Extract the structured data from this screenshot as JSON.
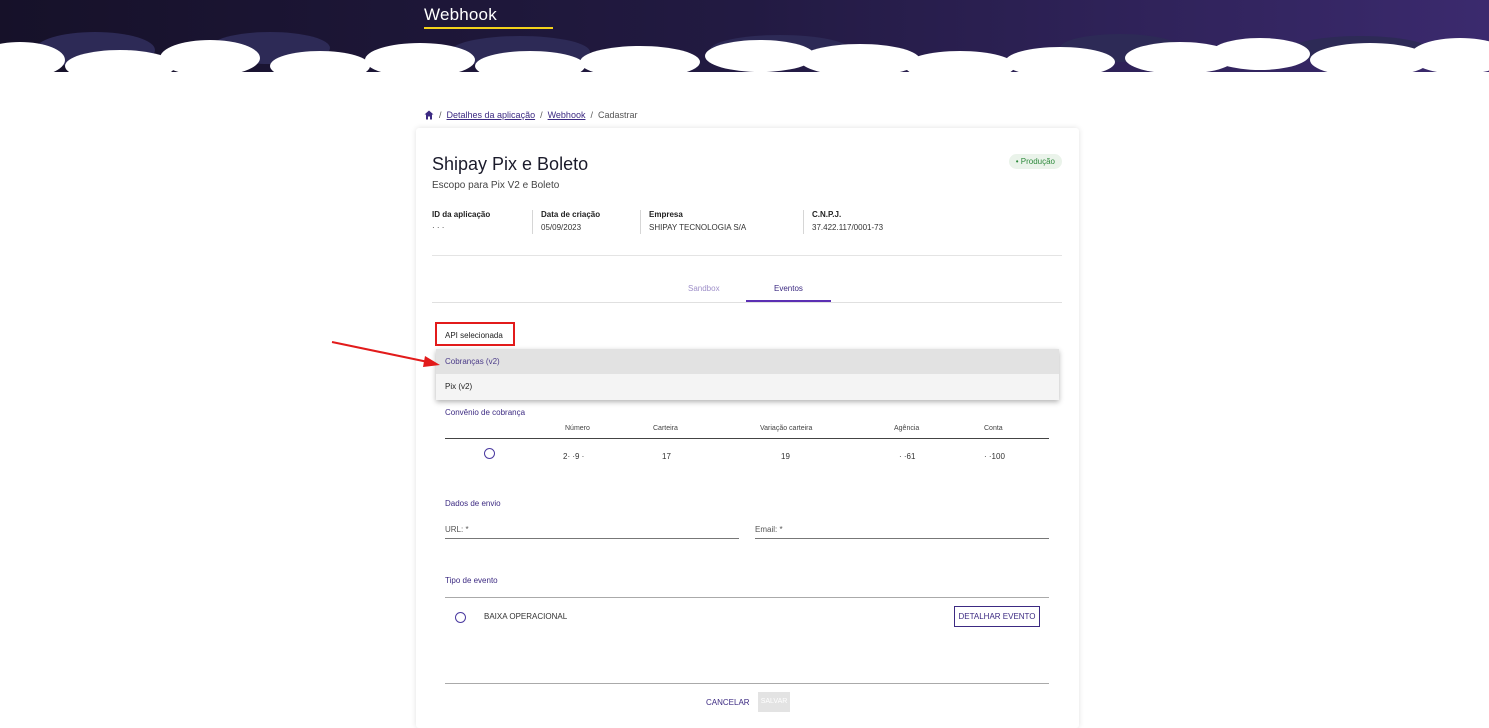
{
  "header": {
    "title": "Webhook"
  },
  "breadcrumb": {
    "home_icon": "home-icon",
    "items": [
      "Detalhes da aplicação",
      "Webhook"
    ],
    "current": "Cadastrar",
    "separator": "/"
  },
  "app": {
    "name": "Shipay Pix e Boleto",
    "scope": "Escopo para Pix V2 e Boleto",
    "environment_badge": "• Produção"
  },
  "info": {
    "id_label": "ID da aplicação",
    "id_value": "· · ·",
    "created_label": "Data de criação",
    "created_value": "05/09/2023",
    "company_label": "Empresa",
    "company_value": "SHIPAY TECNOLOGIA S/A",
    "cnpj_label": "C.N.P.J.",
    "cnpj_value": "37.422.117/0001-73"
  },
  "tabs": [
    {
      "label": "Sandbox",
      "active": false
    },
    {
      "label": "Eventos",
      "active": true
    }
  ],
  "api_select": {
    "label": "API selecionada",
    "options": [
      "Cobranças (v2)",
      "Pix (v2)"
    ],
    "highlighted": "Cobranças (v2)"
  },
  "convenio": {
    "title": "Convênio de cobrança",
    "columns": [
      "Número",
      "Carteira",
      "Variação carteira",
      "Agência",
      "Conta"
    ],
    "rows": [
      {
        "numero": "2· ·9 ·",
        "carteira": "17",
        "variacao": "19",
        "agencia": "· ·61",
        "conta": "· ·100"
      }
    ]
  },
  "envio": {
    "title": "Dados de envio",
    "url_label": "URL: *",
    "email_label": "Email: *"
  },
  "evento": {
    "title": "Tipo de evento",
    "items": [
      {
        "label": "BAIXA OPERACIONAL",
        "button": "DETALHAR EVENTO"
      }
    ]
  },
  "actions": {
    "cancel": "CANCELAR",
    "save": "SALVAR"
  },
  "colors": {
    "accent": "#3c2a82",
    "highlight_box": "#e21b1b",
    "underline": "#f3d21b",
    "badge_text": "#2e8a3c"
  }
}
